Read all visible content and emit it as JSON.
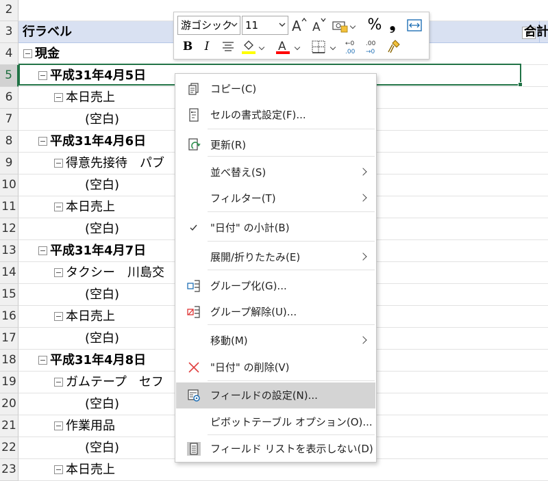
{
  "sheet": {
    "rows": [
      {
        "num": "2",
        "text": "",
        "level": -1
      },
      {
        "num": "3",
        "text": "行ラベル",
        "level": 0,
        "header": true,
        "right_header": "合計"
      },
      {
        "num": "4",
        "text": "現金",
        "level": 0,
        "bold": true,
        "collapse": true
      },
      {
        "num": "5",
        "text": "平成31年4月5日",
        "level": 1,
        "bold": true,
        "collapse": true,
        "selected": true
      },
      {
        "num": "6",
        "text": "本日売上",
        "level": 2,
        "collapse": true
      },
      {
        "num": "7",
        "text": "(空白)",
        "level": 3
      },
      {
        "num": "8",
        "text": "平成31年4月6日",
        "level": 1,
        "bold": true,
        "collapse": true
      },
      {
        "num": "9",
        "text": "得意先接待　パブ",
        "level": 2,
        "collapse": true
      },
      {
        "num": "10",
        "text": "(空白)",
        "level": 3
      },
      {
        "num": "11",
        "text": "本日売上",
        "level": 2,
        "collapse": true
      },
      {
        "num": "12",
        "text": "(空白)",
        "level": 3
      },
      {
        "num": "13",
        "text": "平成31年4月7日",
        "level": 1,
        "bold": true,
        "collapse": true
      },
      {
        "num": "14",
        "text": "タクシー　川島交",
        "level": 2,
        "collapse": true
      },
      {
        "num": "15",
        "text": "(空白)",
        "level": 3
      },
      {
        "num": "16",
        "text": "本日売上",
        "level": 2,
        "collapse": true
      },
      {
        "num": "17",
        "text": "(空白)",
        "level": 3
      },
      {
        "num": "18",
        "text": "平成31年4月8日",
        "level": 1,
        "bold": true,
        "collapse": true
      },
      {
        "num": "19",
        "text": "ガムテープ　セフ",
        "level": 2,
        "collapse": true
      },
      {
        "num": "20",
        "text": "(空白)",
        "level": 3
      },
      {
        "num": "21",
        "text": "作業用品",
        "level": 2,
        "collapse": true
      },
      {
        "num": "22",
        "text": "(空白)",
        "level": 3
      },
      {
        "num": "23",
        "text": "本日売上",
        "level": 2,
        "collapse": true
      }
    ]
  },
  "toolbar": {
    "font_name": "游ゴシック",
    "font_size": "11",
    "percent": "%",
    "comma": "❟",
    "bold": "B",
    "italic": "I"
  },
  "menu": {
    "items": [
      {
        "id": "copy",
        "label": "コピー(C)",
        "icon": "copy-icon"
      },
      {
        "id": "format-cells",
        "label": "セルの書式設定(F)...",
        "icon": "format-cells-icon"
      },
      {
        "id": "refresh",
        "label": "更新(R)",
        "icon": "refresh-icon"
      },
      {
        "id": "sort",
        "label": "並べ替え(S)",
        "submenu": true
      },
      {
        "id": "filter",
        "label": "フィルター(T)",
        "submenu": true
      },
      {
        "id": "subtotal",
        "label": "\"日付\" の小計(B)",
        "icon": "checkmark-icon"
      },
      {
        "id": "expand-collapse",
        "label": "展開/折りたたみ(E)",
        "submenu": true
      },
      {
        "id": "group",
        "label": "グループ化(G)...",
        "icon": "group-icon"
      },
      {
        "id": "ungroup",
        "label": "グループ解除(U)...",
        "icon": "ungroup-icon"
      },
      {
        "id": "move",
        "label": "移動(M)",
        "submenu": true
      },
      {
        "id": "remove",
        "label": "\"日付\" の削除(V)",
        "icon": "delete-x-icon"
      },
      {
        "id": "field-settings",
        "label": "フィールドの設定(N)...",
        "icon": "field-settings-icon",
        "highlighted": true
      },
      {
        "id": "pivot-options",
        "label": "ピボットテーブル オプション(O)..."
      },
      {
        "id": "hide-field-list",
        "label": "フィールド リストを表示しない(D)",
        "icon": "field-list-icon"
      }
    ]
  },
  "colors": {
    "accent": "#217346",
    "header_fill": "#d9e1f2",
    "highlight_fill": "#ffff00",
    "font_color": "#ff0000",
    "delete_red": "#e04040"
  }
}
